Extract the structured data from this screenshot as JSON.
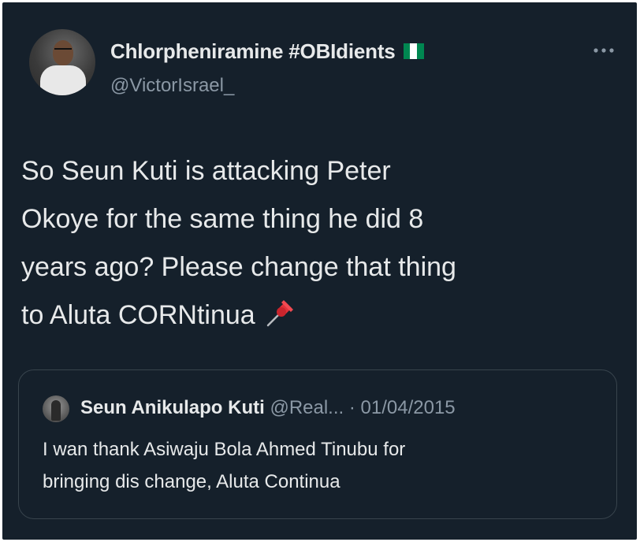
{
  "tweet": {
    "author": {
      "display_name": "Chlorpheniramine #OBIdients",
      "handle": "@VictorIsrael_",
      "flag_icon": "nigeria-flag-icon",
      "flag_colors": [
        "#008751",
        "#ffffff",
        "#008751"
      ]
    },
    "more_icon": "ellipsis-icon",
    "text_lines": [
      "So Seun Kuti is attacking Peter",
      "Okoye for the same thing he did 8",
      "years ago? Please change that thing",
      "to Aluta CORNtinua"
    ],
    "text_emoji_icon": "pushpin-icon",
    "quoted": {
      "display_name": "Seun Anikulapo Kuti",
      "handle_truncated": "@Real...",
      "separator": "·",
      "date": "01/04/2015",
      "text_lines": [
        "I wan thank Asiwaju Bola Ahmed Tinubu for",
        "bringing dis change, Aluta Continua"
      ]
    }
  },
  "colors": {
    "background": "#15202b",
    "primary_text": "#e7e9ea",
    "secondary_text": "#8b98a5",
    "border": "#38444d"
  }
}
